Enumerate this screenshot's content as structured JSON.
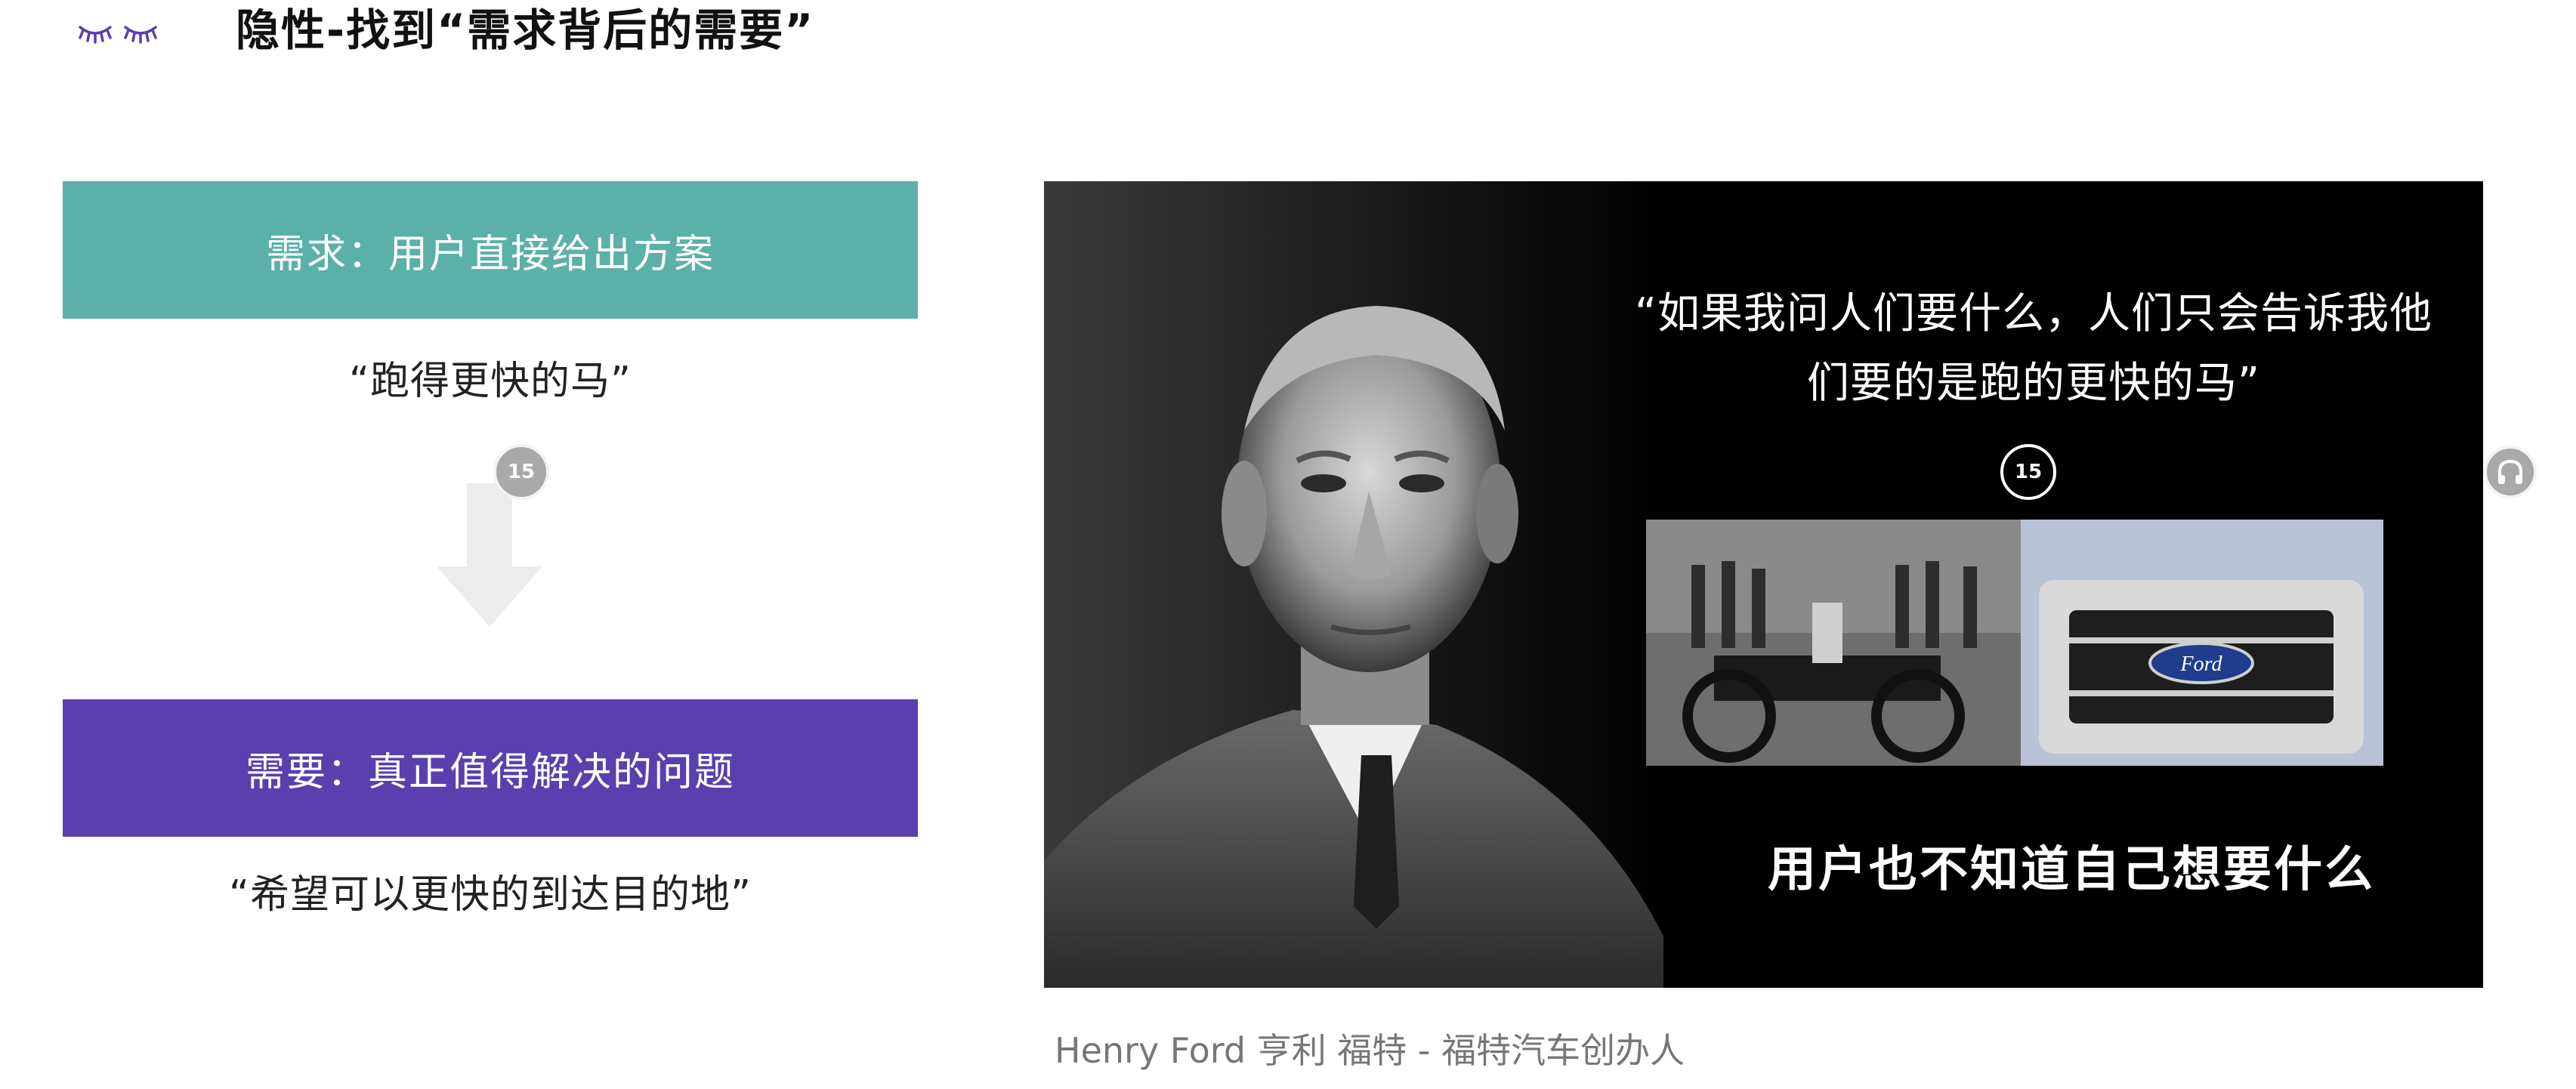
{
  "header": {
    "title": "隐性-找到“需求背后的需要”"
  },
  "left_panel": {
    "demand_box": "需求：用户直接给出方案",
    "demand_example": "“跑得更快的马”",
    "need_box": "需要：真正值得解决的问题",
    "need_example": "“希望可以更快的到达目的地”"
  },
  "player_controls": {
    "rewind_label": "15",
    "forward_label": "15",
    "rewind_icon": "rewind-15-icon",
    "forward_icon": "forward-15-icon",
    "headphones_icon": "headphones-icon"
  },
  "slide_image": {
    "quote": "“如果我问人们要什么，人们只会告诉我他们要的是跑的更快的马”",
    "tagline": "用户也不知道自己想要什么",
    "car_logo_text": "Ford"
  },
  "caption": "Henry Ford 亨利 福特 - 福特汽车创办人",
  "colors": {
    "teal": "#5bb0aa",
    "purple": "#5a3fae",
    "accent_logo": "#5a3fae"
  }
}
